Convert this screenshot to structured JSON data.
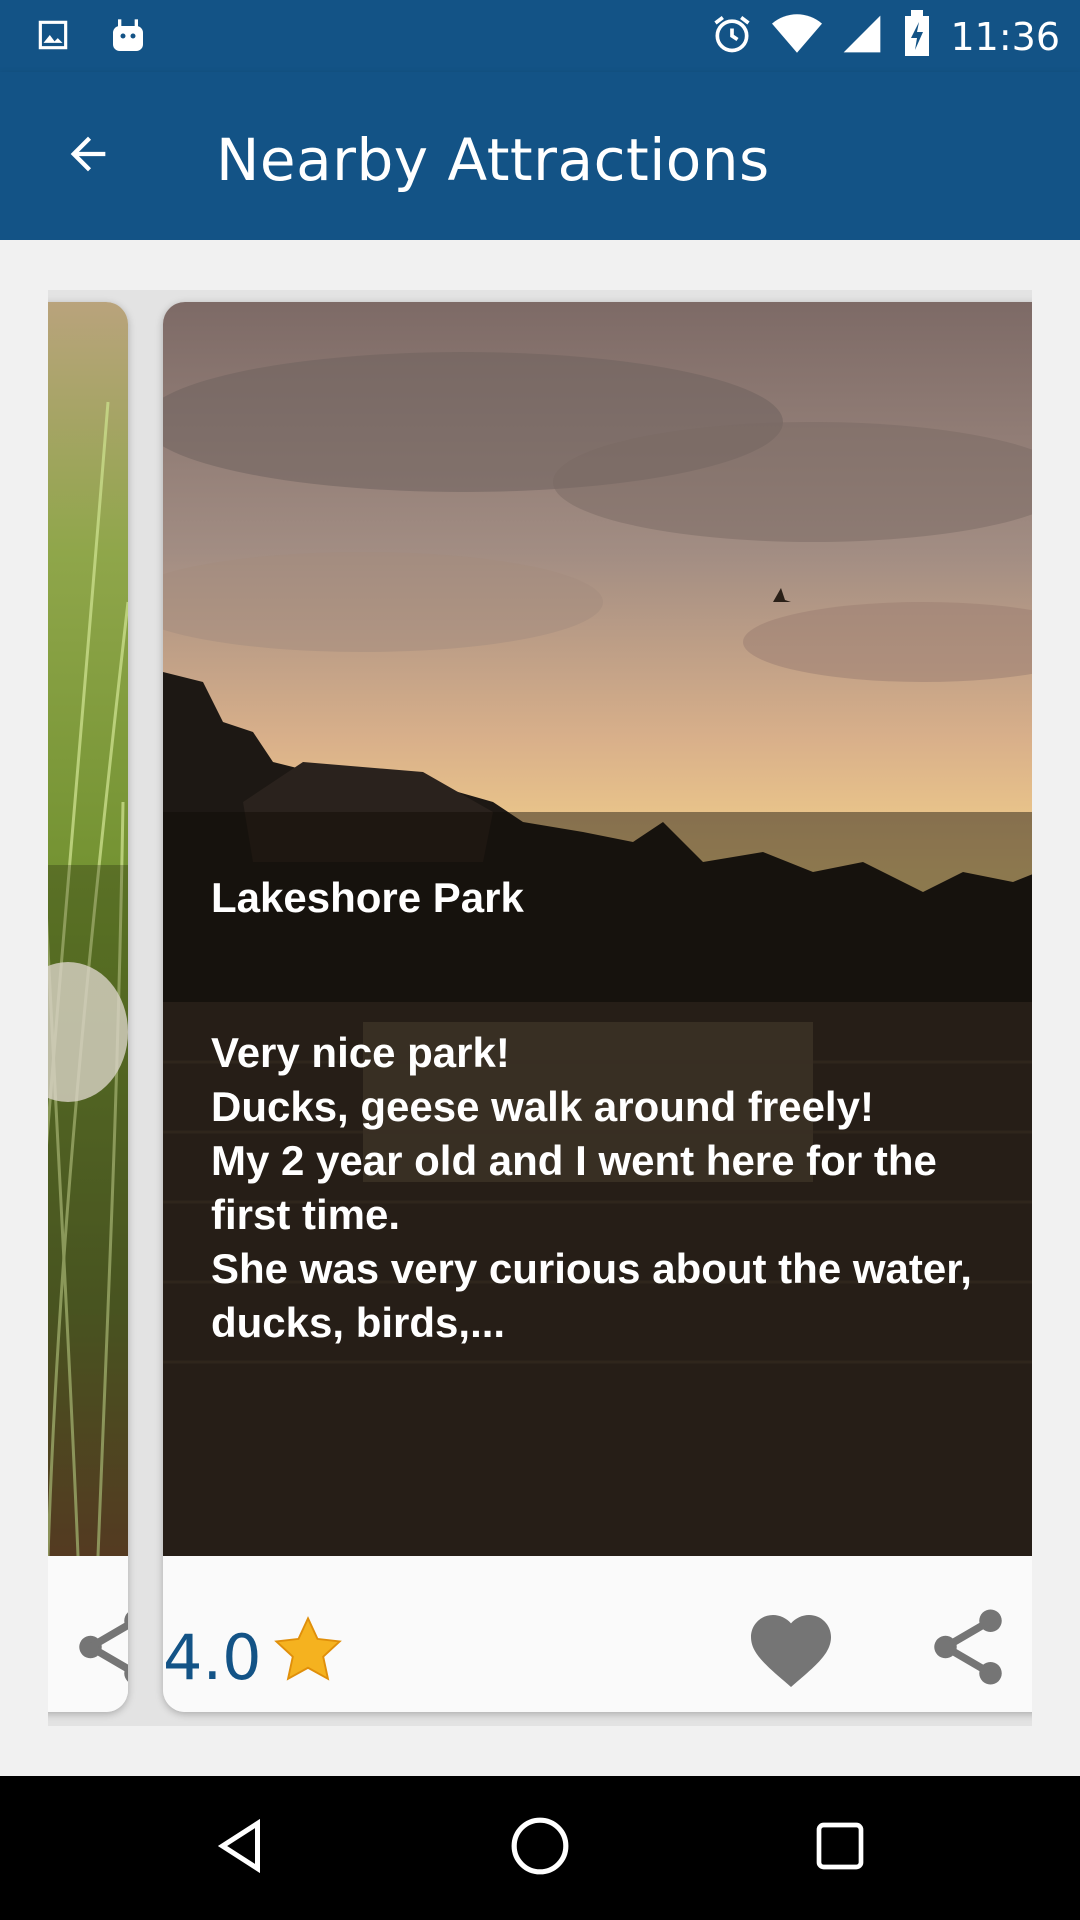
{
  "status_bar": {
    "time": "11:36",
    "icons": [
      "image-icon",
      "android-icon",
      "alarm-icon",
      "wifi-icon",
      "signal-icon",
      "battery-charging-icon"
    ]
  },
  "app_bar": {
    "title": "Nearby Attractions",
    "back_icon": "arrow-back-icon"
  },
  "cards": {
    "main": {
      "title": "Lakeshore Park",
      "review": "Very nice park!\nDucks, geese walk around freely!\nMy 2 year old and I went here for the first time.\nShe was very curious about the water, ducks, birds,...",
      "rating": "4.0",
      "actions": [
        "heart-icon",
        "share-icon"
      ]
    },
    "left_peek": {
      "actions": [
        "share-icon"
      ]
    }
  },
  "nav_bar": {
    "buttons": [
      "back-icon",
      "home-icon",
      "recents-icon"
    ]
  },
  "colors": {
    "primary": "#135386",
    "rating_text": "#135386",
    "star": "#f5b21f",
    "action_icon": "#757575"
  }
}
